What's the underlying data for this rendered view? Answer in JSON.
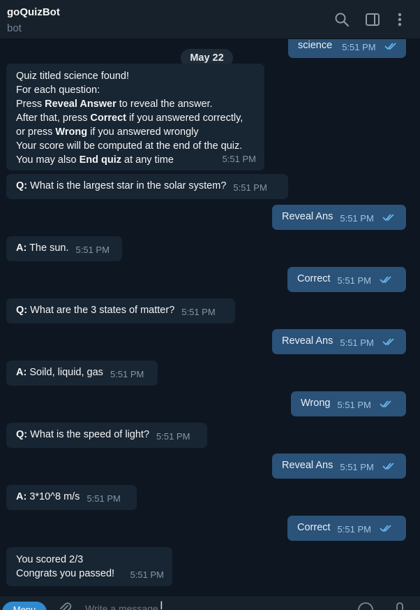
{
  "header": {
    "title": "goQuizBot",
    "subtitle": "bot",
    "icons": [
      "search-icon",
      "sidebar-panel-icon",
      "more-vertical-icon"
    ]
  },
  "chat": {
    "date_label": "May 22",
    "top_message": {
      "text": "science",
      "time": "5:51 PM"
    },
    "intro": {
      "lines": [
        [
          "Quiz titled science found!"
        ],
        [
          "For each question:"
        ],
        [
          "Press ",
          "Reveal Answer",
          " to reveal the answer."
        ],
        [
          "After that, press ",
          "Correct",
          " if you answered correctly,"
        ],
        [
          "or press ",
          "Wrong",
          " if you answered wrongly"
        ],
        [
          "Your score will be computed at the end of the quiz."
        ],
        [
          "You may also ",
          "End quiz",
          " at any time"
        ]
      ],
      "time": "5:51 PM"
    },
    "messages": [
      {
        "from": "bot",
        "prefix": "Q:",
        "text": " What is the largest star in the solar system?",
        "time": "5:51 PM"
      },
      {
        "from": "me",
        "text": "Reveal Ans",
        "time": "5:51 PM"
      },
      {
        "from": "bot",
        "prefix": "A:",
        "text": " The sun.",
        "time": "5:51 PM"
      },
      {
        "from": "me",
        "text": "Correct",
        "time": "5:51 PM"
      },
      {
        "from": "bot",
        "prefix": "Q:",
        "text": " What are the 3 states of matter?",
        "time": "5:51 PM"
      },
      {
        "from": "me",
        "text": "Reveal Ans",
        "time": "5:51 PM"
      },
      {
        "from": "bot",
        "prefix": "A:",
        "text": " Soild, liquid, gas",
        "time": "5:51 PM"
      },
      {
        "from": "me",
        "text": "Wrong",
        "time": "5:51 PM"
      },
      {
        "from": "bot",
        "prefix": "Q:",
        "text": " What is the speed of light?",
        "time": "5:51 PM"
      },
      {
        "from": "me",
        "text": "Reveal Ans",
        "time": "5:51 PM"
      },
      {
        "from": "bot",
        "prefix": "A:",
        "text": " 3*10^8 m/s",
        "time": "5:51 PM"
      },
      {
        "from": "me",
        "text": "Correct",
        "time": "5:51 PM"
      }
    ],
    "final": {
      "line1": "You scored 2/3",
      "line2": "Congrats you passed!",
      "time": "5:51 PM"
    }
  },
  "footer": {
    "menu_label": "Menu",
    "input_placeholder": "Write a message...",
    "icons": [
      "attach-icon",
      "emoji-icon",
      "microphone-icon"
    ]
  },
  "colors": {
    "background": "#0e1621",
    "header": "#17212b",
    "bot_bubble": "#182533",
    "my_bubble": "#2b5278",
    "check": "#64b5ef"
  }
}
